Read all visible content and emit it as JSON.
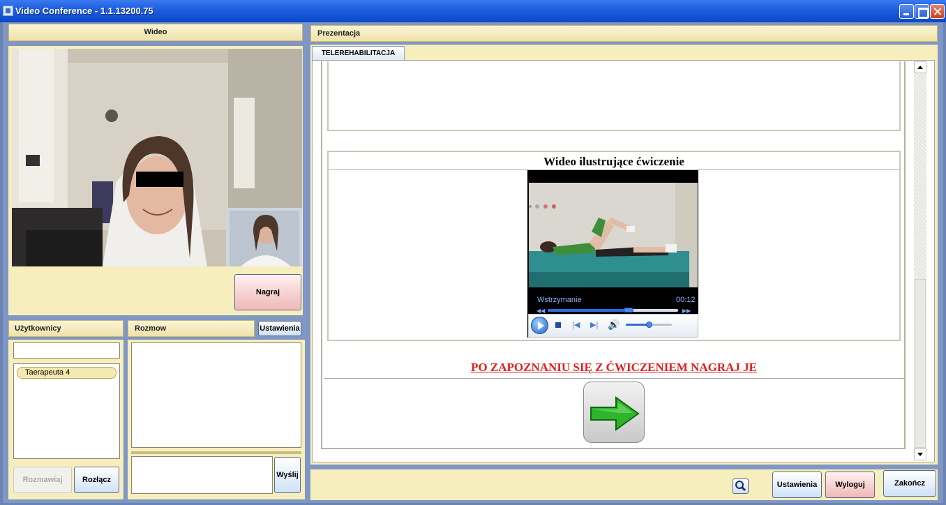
{
  "window": {
    "title": "Video Conference - 1.1.13200.75"
  },
  "video": {
    "header": "Wideo",
    "record_label": "Nagraj"
  },
  "users": {
    "header": "Użytkownicy",
    "search_value": "",
    "items": [
      {
        "label": "Taerapeuta 4"
      }
    ],
    "talk_label": "Rozmawiaj",
    "disconnect_label": "Rozłącz"
  },
  "chat": {
    "header": "Rozmow",
    "settings_label": "Ustawienia",
    "send_label": "Wyślij"
  },
  "presentation": {
    "header": "Prezentacja",
    "tab_label": "TELEREHABILITACJA",
    "video_section_title": "Wideo ilustrujące ćwiczenie",
    "player": {
      "status": "Wstrzymanie",
      "time": "00:12",
      "progress": 0.62,
      "volume": 0.52
    },
    "instruction": "PO ZAPOZNANIU SIĘ Z ĆWICZENIEM NAGRAJ JE"
  },
  "footer": {
    "settings_label": "Ustawienia",
    "logout_label": "Wyloguj",
    "end_label": "Zakończ"
  },
  "colors": {
    "panel_bg": "#f7eebd",
    "titlebar": "#1e5fe0",
    "instruction_text": "#e41d1d",
    "record_button": "#f0b8b8",
    "player_accent": "#2f6bdc"
  }
}
